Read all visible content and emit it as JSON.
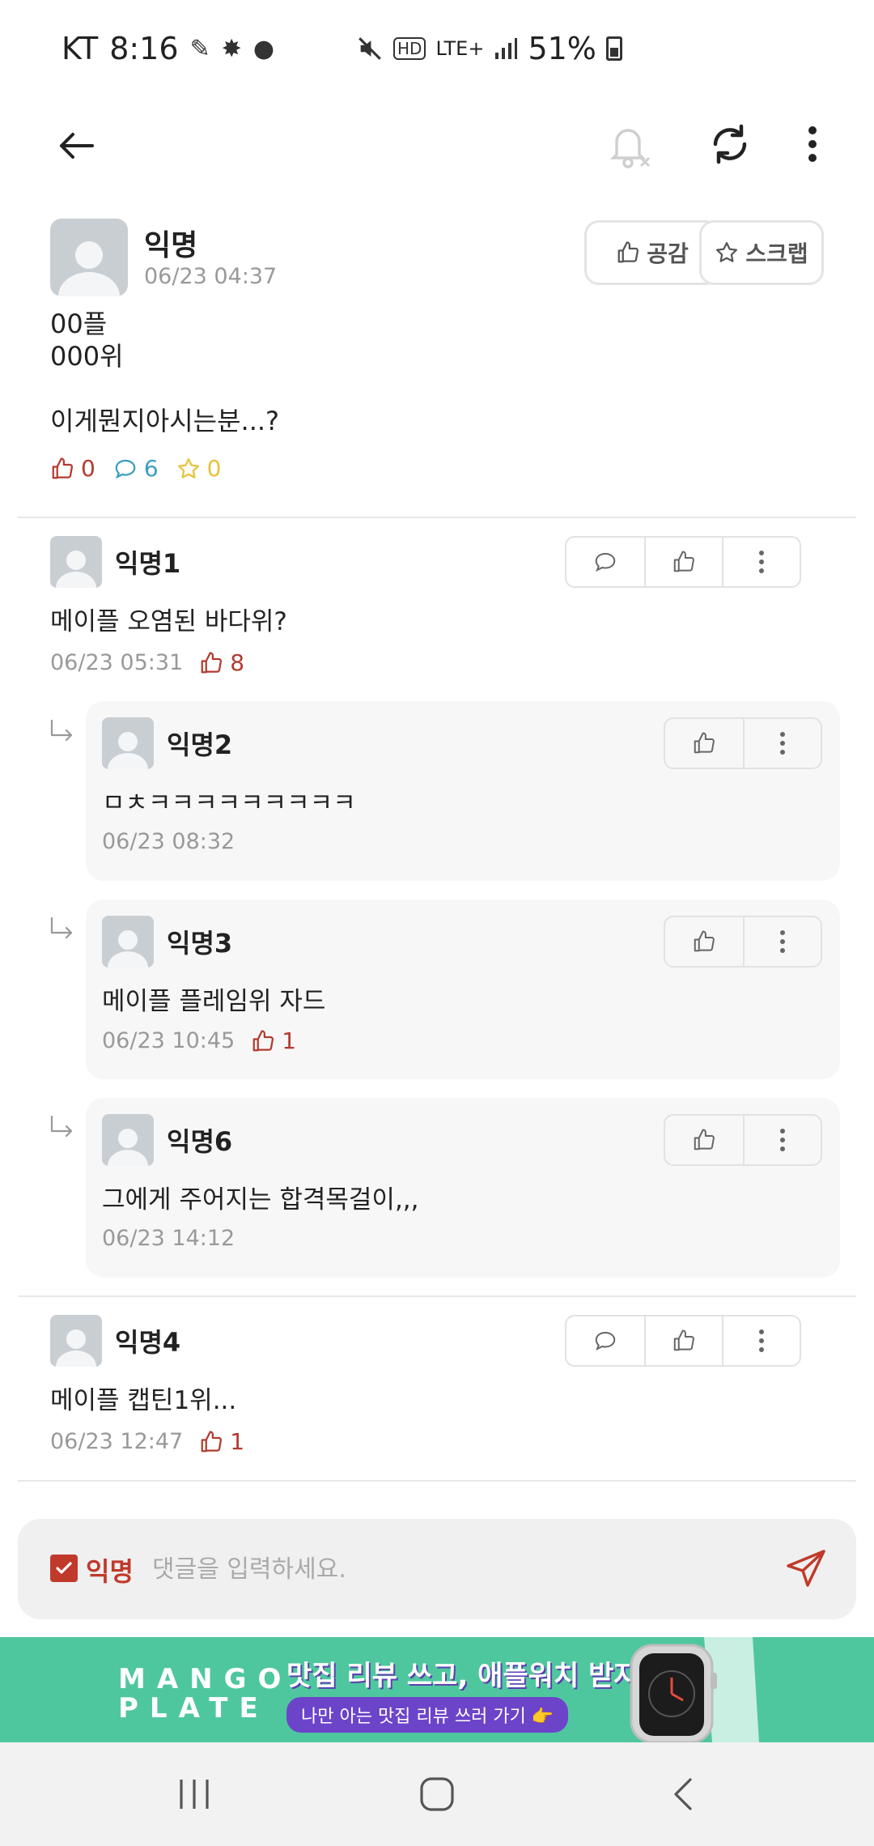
{
  "status_bar": {
    "carrier": "KT",
    "time": "8:16",
    "network": "LTE+",
    "battery": "51%"
  },
  "post": {
    "author": "익명",
    "time": "06/23 04:37",
    "like_label": "공감",
    "scrap_label": "스크랩",
    "body": "00플\n000위\n\n이게뭔지아시는분...?",
    "likes": "0",
    "comments": "6",
    "scraps": "0"
  },
  "comments": [
    {
      "author": "익명1",
      "text": "메이플 오염된 바다위?",
      "time": "06/23 05:31",
      "likes": "8"
    },
    {
      "author": "익명2",
      "text": "ㅁㅊㅋㅋㅋㅋㅋㅋㅋㅋㅋ",
      "time": "06/23 08:32",
      "likes": ""
    },
    {
      "author": "익명3",
      "text": "메이플 플레임위 자드",
      "time": "06/23 10:45",
      "likes": "1"
    },
    {
      "author": "익명6",
      "text": "그에게 주어지는 합격목걸이,,,",
      "time": "06/23 14:12",
      "likes": ""
    },
    {
      "author": "익명4",
      "text": "메이플 캡틴1위...",
      "time": "06/23 12:47",
      "likes": "1"
    }
  ],
  "input": {
    "anon_label": "익명",
    "placeholder": "댓글을 입력하세요."
  },
  "ad": {
    "logo": "MANGO PLATE",
    "headline": "맛집 리뷰 쓰고, 애플워치 받자!",
    "subline": "나만 아는 맛집 리뷰 쓰러 가기 👉"
  },
  "colors": {
    "accent_red": "#c0392b",
    "like_red": "#b23b2f",
    "comment_teal": "#3a9fc0",
    "scrap_yellow": "#e8c23a",
    "ad_green": "#4fc79e"
  }
}
